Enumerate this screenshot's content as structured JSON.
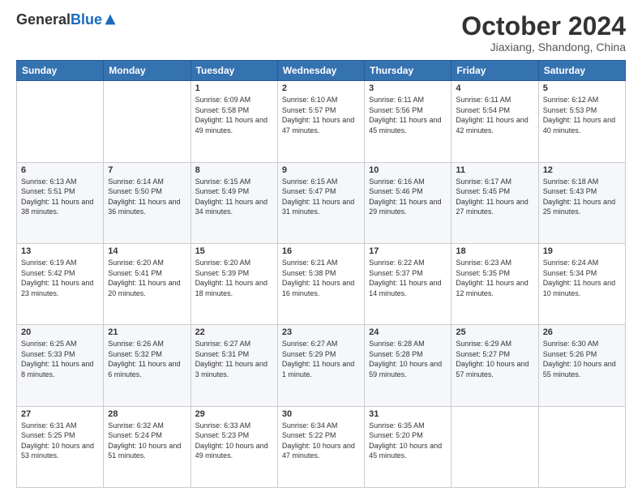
{
  "header": {
    "logo_general": "General",
    "logo_blue": "Blue",
    "month_title": "October 2024",
    "subtitle": "Jiaxiang, Shandong, China"
  },
  "weekdays": [
    "Sunday",
    "Monday",
    "Tuesday",
    "Wednesday",
    "Thursday",
    "Friday",
    "Saturday"
  ],
  "weeks": [
    [
      {
        "day": null,
        "info": null
      },
      {
        "day": null,
        "info": null
      },
      {
        "day": "1",
        "info": "Sunrise: 6:09 AM\nSunset: 5:58 PM\nDaylight: 11 hours and 49 minutes."
      },
      {
        "day": "2",
        "info": "Sunrise: 6:10 AM\nSunset: 5:57 PM\nDaylight: 11 hours and 47 minutes."
      },
      {
        "day": "3",
        "info": "Sunrise: 6:11 AM\nSunset: 5:56 PM\nDaylight: 11 hours and 45 minutes."
      },
      {
        "day": "4",
        "info": "Sunrise: 6:11 AM\nSunset: 5:54 PM\nDaylight: 11 hours and 42 minutes."
      },
      {
        "day": "5",
        "info": "Sunrise: 6:12 AM\nSunset: 5:53 PM\nDaylight: 11 hours and 40 minutes."
      }
    ],
    [
      {
        "day": "6",
        "info": "Sunrise: 6:13 AM\nSunset: 5:51 PM\nDaylight: 11 hours and 38 minutes."
      },
      {
        "day": "7",
        "info": "Sunrise: 6:14 AM\nSunset: 5:50 PM\nDaylight: 11 hours and 36 minutes."
      },
      {
        "day": "8",
        "info": "Sunrise: 6:15 AM\nSunset: 5:49 PM\nDaylight: 11 hours and 34 minutes."
      },
      {
        "day": "9",
        "info": "Sunrise: 6:15 AM\nSunset: 5:47 PM\nDaylight: 11 hours and 31 minutes."
      },
      {
        "day": "10",
        "info": "Sunrise: 6:16 AM\nSunset: 5:46 PM\nDaylight: 11 hours and 29 minutes."
      },
      {
        "day": "11",
        "info": "Sunrise: 6:17 AM\nSunset: 5:45 PM\nDaylight: 11 hours and 27 minutes."
      },
      {
        "day": "12",
        "info": "Sunrise: 6:18 AM\nSunset: 5:43 PM\nDaylight: 11 hours and 25 minutes."
      }
    ],
    [
      {
        "day": "13",
        "info": "Sunrise: 6:19 AM\nSunset: 5:42 PM\nDaylight: 11 hours and 23 minutes."
      },
      {
        "day": "14",
        "info": "Sunrise: 6:20 AM\nSunset: 5:41 PM\nDaylight: 11 hours and 20 minutes."
      },
      {
        "day": "15",
        "info": "Sunrise: 6:20 AM\nSunset: 5:39 PM\nDaylight: 11 hours and 18 minutes."
      },
      {
        "day": "16",
        "info": "Sunrise: 6:21 AM\nSunset: 5:38 PM\nDaylight: 11 hours and 16 minutes."
      },
      {
        "day": "17",
        "info": "Sunrise: 6:22 AM\nSunset: 5:37 PM\nDaylight: 11 hours and 14 minutes."
      },
      {
        "day": "18",
        "info": "Sunrise: 6:23 AM\nSunset: 5:35 PM\nDaylight: 11 hours and 12 minutes."
      },
      {
        "day": "19",
        "info": "Sunrise: 6:24 AM\nSunset: 5:34 PM\nDaylight: 11 hours and 10 minutes."
      }
    ],
    [
      {
        "day": "20",
        "info": "Sunrise: 6:25 AM\nSunset: 5:33 PM\nDaylight: 11 hours and 8 minutes."
      },
      {
        "day": "21",
        "info": "Sunrise: 6:26 AM\nSunset: 5:32 PM\nDaylight: 11 hours and 6 minutes."
      },
      {
        "day": "22",
        "info": "Sunrise: 6:27 AM\nSunset: 5:31 PM\nDaylight: 11 hours and 3 minutes."
      },
      {
        "day": "23",
        "info": "Sunrise: 6:27 AM\nSunset: 5:29 PM\nDaylight: 11 hours and 1 minute."
      },
      {
        "day": "24",
        "info": "Sunrise: 6:28 AM\nSunset: 5:28 PM\nDaylight: 10 hours and 59 minutes."
      },
      {
        "day": "25",
        "info": "Sunrise: 6:29 AM\nSunset: 5:27 PM\nDaylight: 10 hours and 57 minutes."
      },
      {
        "day": "26",
        "info": "Sunrise: 6:30 AM\nSunset: 5:26 PM\nDaylight: 10 hours and 55 minutes."
      }
    ],
    [
      {
        "day": "27",
        "info": "Sunrise: 6:31 AM\nSunset: 5:25 PM\nDaylight: 10 hours and 53 minutes."
      },
      {
        "day": "28",
        "info": "Sunrise: 6:32 AM\nSunset: 5:24 PM\nDaylight: 10 hours and 51 minutes."
      },
      {
        "day": "29",
        "info": "Sunrise: 6:33 AM\nSunset: 5:23 PM\nDaylight: 10 hours and 49 minutes."
      },
      {
        "day": "30",
        "info": "Sunrise: 6:34 AM\nSunset: 5:22 PM\nDaylight: 10 hours and 47 minutes."
      },
      {
        "day": "31",
        "info": "Sunrise: 6:35 AM\nSunset: 5:20 PM\nDaylight: 10 hours and 45 minutes."
      },
      {
        "day": null,
        "info": null
      },
      {
        "day": null,
        "info": null
      }
    ]
  ]
}
